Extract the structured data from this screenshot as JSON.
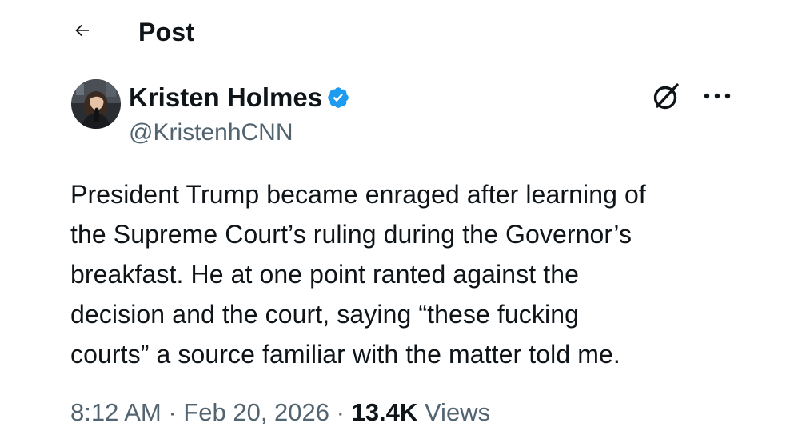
{
  "header": {
    "back_icon": "arrow-left-icon",
    "title": "Post"
  },
  "author": {
    "display_name": "Kristen Holmes",
    "handle": "@KristenhCNN",
    "verified_icon": "verified-badge-icon",
    "verified_color": "#1d9bf0"
  },
  "actions": {
    "grok_icon": "grok-icon",
    "more_icon": "more-dots-icon"
  },
  "tweet": {
    "text": "President Trump became enraged after learning of\nthe Supreme Court’s ruling during the Governor’s\nbreakfast. He at one point ranted against the\ndecision and the court, saying “these fucking\ncourts” a source familiar with the matter told me."
  },
  "meta": {
    "time": "8:12 AM",
    "separator": " · ",
    "date": "Feb 20, 2026",
    "views_count": "13.4K",
    "views_label": "Views"
  },
  "colors": {
    "text_primary": "#0f1419",
    "text_secondary": "#536471",
    "accent": "#1d9bf0",
    "border": "#eff3f4"
  }
}
